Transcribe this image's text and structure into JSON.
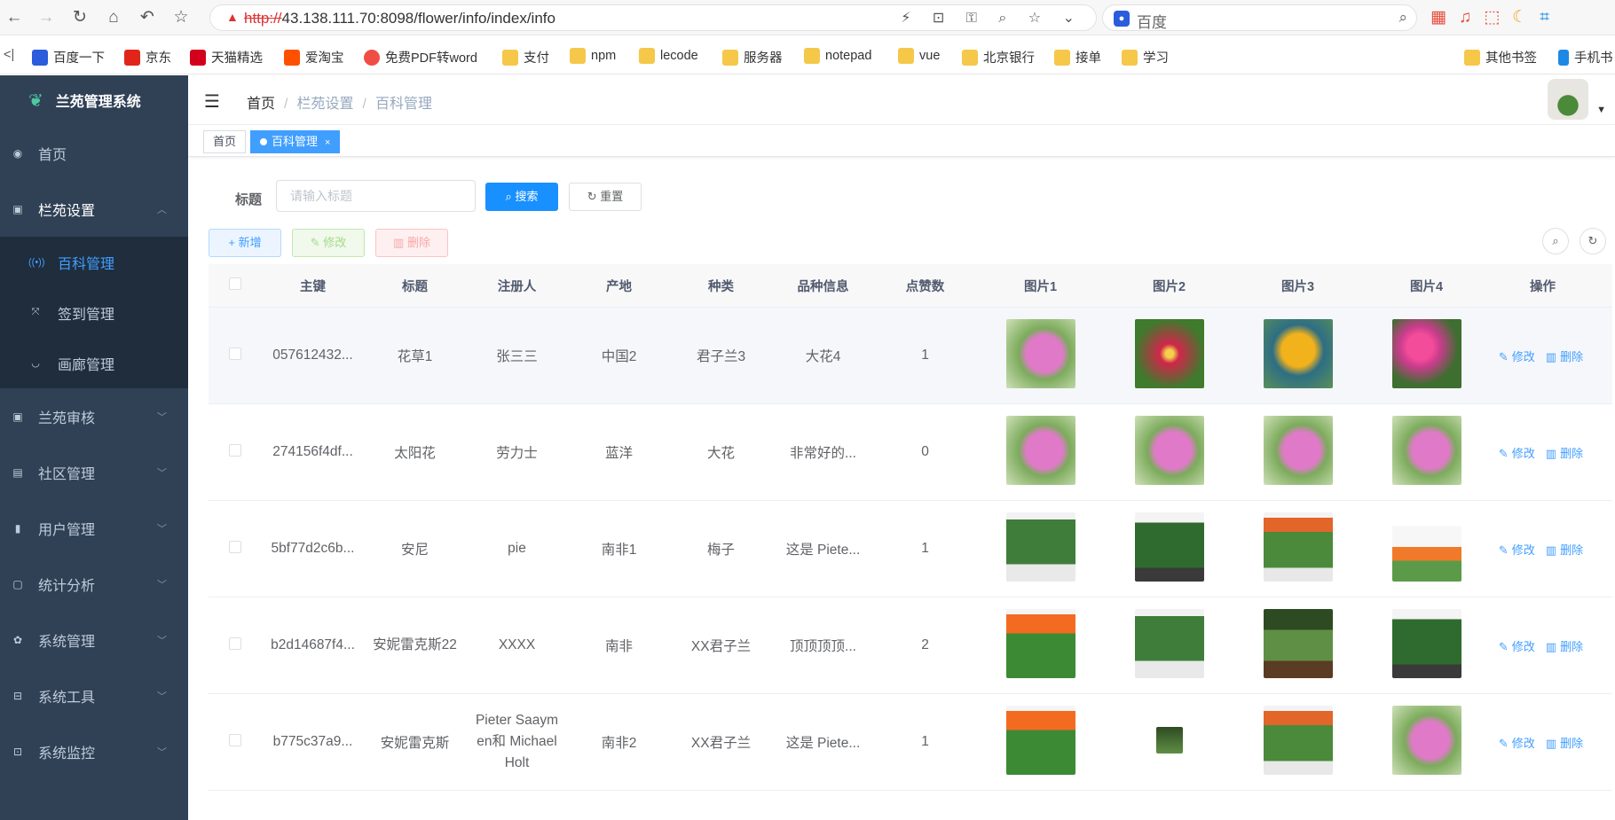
{
  "browser": {
    "url_scheme": "http://",
    "url_rest": "43.138.111.70:8098/flower/info/index/info",
    "search_engine": "百度",
    "bookmarks": [
      "百度一下",
      "京东",
      "天猫精选",
      "爱淘宝",
      "免费PDF转word",
      "支付",
      "npm",
      "lecode",
      "服务器",
      "notepad",
      "vue",
      "北京银行",
      "接单",
      "学习",
      "其他书签",
      "手机书"
    ]
  },
  "sidebar": {
    "title": "兰苑管理系统",
    "items": [
      {
        "label": "首页",
        "icon": "dashboard-icon"
      },
      {
        "label": "栏苑设置",
        "icon": "form-icon"
      },
      {
        "label": "兰苑审核",
        "icon": "form-icon"
      },
      {
        "label": "社区管理",
        "icon": "edit-icon"
      },
      {
        "label": "用户管理",
        "icon": "user-icon"
      },
      {
        "label": "统计分析",
        "icon": "chart-icon"
      },
      {
        "label": "系统管理",
        "icon": "gear-icon"
      },
      {
        "label": "系统工具",
        "icon": "tool-icon"
      },
      {
        "label": "系统监控",
        "icon": "monitor-icon"
      }
    ],
    "subitems": [
      {
        "label": "百科管理",
        "icon": "wiki-icon"
      },
      {
        "label": "签到管理",
        "icon": "fullscreen-icon"
      },
      {
        "label": "画廊管理",
        "icon": "eye-icon"
      }
    ]
  },
  "navbar": {
    "breadcrumb": [
      "首页",
      "栏苑设置",
      "百科管理"
    ]
  },
  "tags": {
    "home": "首页",
    "active": "百科管理",
    "close": "×"
  },
  "search": {
    "label": "标题",
    "placeholder": "请输入标题",
    "search_btn": "搜索",
    "reset_btn": "重置"
  },
  "toolbar": {
    "add": "新增",
    "edit": "修改",
    "delete": "删除"
  },
  "table": {
    "headers": [
      "主键",
      "标题",
      "注册人",
      "产地",
      "种类",
      "品种信息",
      "点赞数",
      "图片1",
      "图片2",
      "图片3",
      "图片4",
      "操作"
    ],
    "op_edit": "修改",
    "op_delete": "删除",
    "rows": [
      {
        "id": "057612432...",
        "title": "花草1",
        "registrant": "张三三",
        "origin": "中国2",
        "kind": "君子兰3",
        "info": "大花4",
        "likes": "1"
      },
      {
        "id": "274156f4df...",
        "title": "太阳花",
        "registrant": "劳力士",
        "origin": "蓝洋",
        "kind": "大花",
        "info": "非常好的...",
        "likes": "0"
      },
      {
        "id": "5bf77d2c6b...",
        "title": "安尼",
        "registrant": "pie",
        "origin": "南非1",
        "kind": "梅子",
        "info": "这是 Piete...",
        "likes": "1"
      },
      {
        "id": "b2d14687f4...",
        "title": "安妮雷克斯22",
        "registrant": "XXXX",
        "origin": "南非",
        "kind": "XX君子兰",
        "info": "顶顶顶顶...",
        "likes": "2"
      },
      {
        "id": "b775c37a9...",
        "title": "安妮雷克斯",
        "registrant": "Pieter Saaymen和 Michael Holt",
        "origin": "南非2",
        "kind": "XX君子兰",
        "info": "这是 Piete...",
        "likes": "1"
      }
    ]
  },
  "colors": {
    "sidebar_bg": "#304156",
    "submenu_bg": "#1f2d3d",
    "accent": "#409eff"
  }
}
